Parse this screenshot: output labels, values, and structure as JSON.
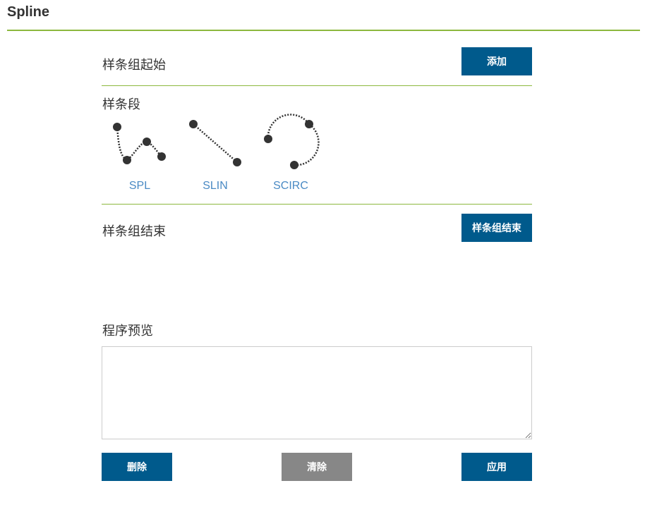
{
  "header": {
    "title": "Spline"
  },
  "group_start": {
    "label": "样条组起始",
    "button_label": "添加"
  },
  "segments": {
    "label": "样条段",
    "items": [
      {
        "label": "SPL",
        "icon": "spline-curve-icon"
      },
      {
        "label": "SLIN",
        "icon": "spline-linear-icon"
      },
      {
        "label": "SCIRC",
        "icon": "spline-circle-icon"
      }
    ]
  },
  "group_end": {
    "label": "样条组结束",
    "button_label": "样条组结束"
  },
  "preview": {
    "label": "程序预览",
    "value": ""
  },
  "footer": {
    "delete_label": "删除",
    "clear_label": "清除",
    "apply_label": "应用"
  },
  "colors": {
    "accent_rule": "#8cb83e",
    "primary_button": "#005a8c",
    "disabled_button": "#878787",
    "segment_label": "#4a8ac4"
  }
}
